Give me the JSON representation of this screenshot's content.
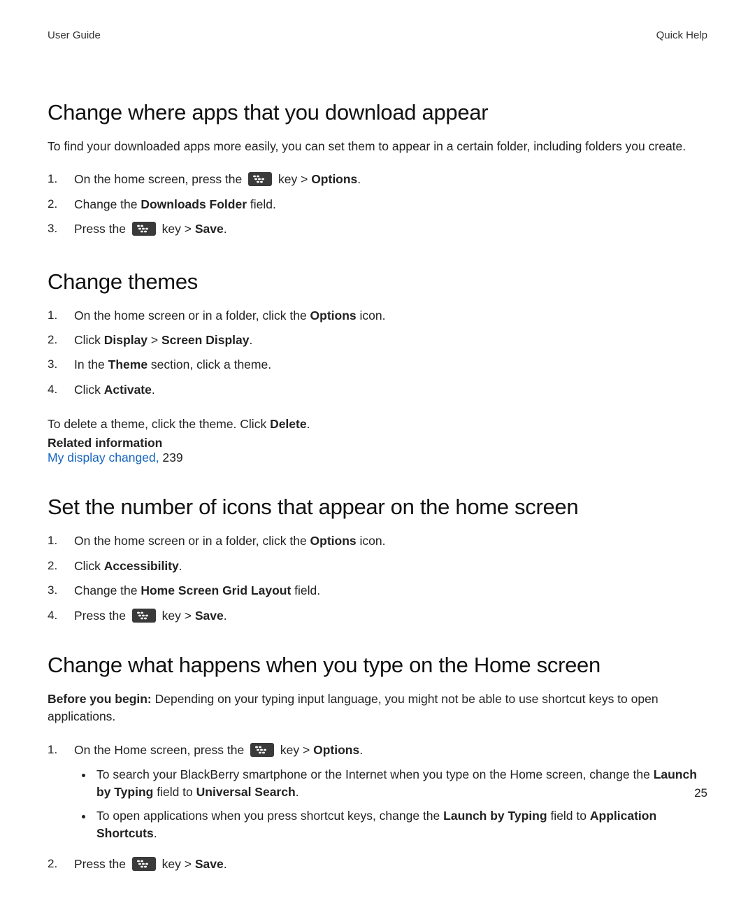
{
  "header": {
    "left": "User Guide",
    "right": "Quick Help"
  },
  "page_number": "25",
  "sections": {
    "s1": {
      "heading": "Change where apps that you download appear",
      "intro": "To find your downloaded apps more easily, you can set them to appear in a certain folder, including folders you create.",
      "steps": [
        {
          "n": "1.",
          "pre": "On the home screen, press the ",
          "mid": " key > ",
          "bold1": "Options",
          "post": "."
        },
        {
          "n": "2.",
          "pre": "Change the ",
          "bold1": "Downloads Folder",
          "post": " field."
        },
        {
          "n": "3.",
          "pre": "Press the ",
          "mid": " key > ",
          "bold1": "Save",
          "post": "."
        }
      ]
    },
    "s2": {
      "heading": "Change themes",
      "steps": [
        {
          "n": "1.",
          "pre": "On the home screen or in a folder, click the ",
          "bold1": "Options",
          "post": " icon."
        },
        {
          "n": "2.",
          "pre": "Click ",
          "bold1": "Display",
          "mid": " > ",
          "bold2": "Screen Display",
          "post": "."
        },
        {
          "n": "3.",
          "pre": "In the ",
          "bold1": "Theme",
          "post": " section, click a theme."
        },
        {
          "n": "4.",
          "pre": "Click ",
          "bold1": "Activate",
          "post": "."
        }
      ],
      "after_pre": "To delete a theme, click the theme. Click ",
      "after_bold": "Delete",
      "after_post": ".",
      "related_label": "Related information",
      "link_text": "My display changed,",
      "link_suffix": " 239"
    },
    "s3": {
      "heading": "Set the number of icons that appear on the home screen",
      "steps": [
        {
          "n": "1.",
          "pre": "On the home screen or in a folder, click the ",
          "bold1": "Options",
          "post": " icon."
        },
        {
          "n": "2.",
          "pre": "Click ",
          "bold1": "Accessibility",
          "post": "."
        },
        {
          "n": "3.",
          "pre": "Change the ",
          "bold1": "Home Screen Grid Layout",
          "post": " field."
        },
        {
          "n": "4.",
          "pre": "Press the ",
          "mid": " key > ",
          "bold1": "Save",
          "post": "."
        }
      ]
    },
    "s4": {
      "heading": "Change what happens when you type on the Home screen",
      "before_label": "Before you begin:",
      "before_text": " Depending on your typing input language, you might not be able to use shortcut keys to open applications.",
      "step1_n": "1.",
      "step1_pre": "On the Home screen, press the ",
      "step1_mid": " key > ",
      "step1_bold": "Options",
      "step1_post": ".",
      "bullets": [
        {
          "pre": "To search your BlackBerry smartphone or the Internet when you type on the Home screen, change the ",
          "b1": "Launch by Typing",
          "mid": " field to ",
          "b2": "Universal Search",
          "post": "."
        },
        {
          "pre": "To open applications when you press shortcut keys, change the ",
          "b1": "Launch by Typing",
          "mid": " field to ",
          "b2": "Application Shortcuts",
          "post": "."
        }
      ],
      "step2_n": "2.",
      "step2_pre": "Press the ",
      "step2_mid": " key > ",
      "step2_bold": "Save",
      "step2_post": "."
    }
  }
}
